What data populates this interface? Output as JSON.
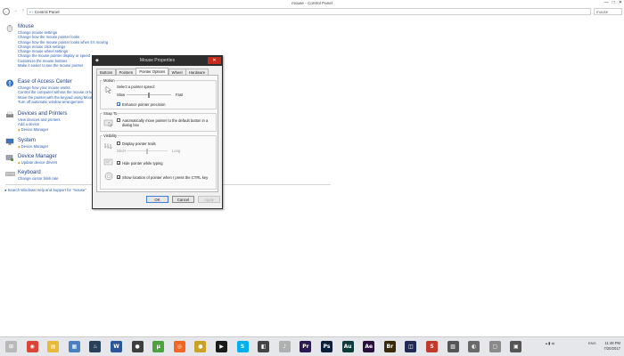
{
  "window": {
    "title": "mouse - Control Panel",
    "controls": [
      "—",
      "□",
      "✕"
    ]
  },
  "address": {
    "path": "Control Panel",
    "search_value": "mouse"
  },
  "nav": {
    "back": "←",
    "forward": "→",
    "up": "↑"
  },
  "sections": [
    {
      "title": "Mouse",
      "icon": "mouse-icon",
      "links": [
        "Change mouse settings",
        "Change how the mouse pointer looks",
        "Change how the mouse pointer looks when it's moving",
        "Change mouse click settings",
        "Change mouse wheel settings",
        "Change the mouse pointer display or speed",
        "Customize the mouse buttons",
        "Make it easier to see the mouse pointer"
      ]
    },
    {
      "title": "Ease of Access Center",
      "icon": "ease-of-access-icon",
      "links": [
        "Change how your mouse works",
        "Control the computer without the mouse or keyboard",
        "Move the pointer with the keypad using MouseKeys",
        "Turn off automatic window arrangement"
      ]
    },
    {
      "title": "Devices and Printers",
      "icon": "devices-printers-icon",
      "links": [
        "View devices and printers",
        "Add a device",
        "Device Manager"
      ]
    },
    {
      "title": "System",
      "icon": "system-icon",
      "links": [
        "Device Manager"
      ]
    },
    {
      "title": "Device Manager",
      "icon": "device-manager-icon",
      "links": [
        "Update device drivers"
      ]
    },
    {
      "title": "Keyboard",
      "icon": "keyboard-icon",
      "links": [
        "Change cursor blink rate"
      ]
    }
  ],
  "help_link": "Search Windows Help and Support for \"mouse\"",
  "dialog": {
    "title": "Mouse Properties",
    "close": "✕",
    "tabs": [
      "Buttons",
      "Pointers",
      "Pointer Options",
      "Wheel",
      "Hardware"
    ],
    "active_tab": "Pointer Options",
    "motion": {
      "label": "Motion",
      "select_speed": "Select a pointer speed:",
      "slow": "Slow",
      "fast": "Fast",
      "speed_level": 0.5,
      "enhance_precision": "Enhance pointer precision",
      "enhance_checked": "✓"
    },
    "snap_to": {
      "label": "Snap To",
      "auto_move": "Automatically move pointer to the default button in a dialog box",
      "checked": ""
    },
    "visibility": {
      "label": "Visibility",
      "display_trails": "Display pointer trails",
      "trails_checked": "",
      "short": "Short",
      "long": "Long",
      "trail_level": 0.5,
      "hide_typing": "Hide pointer while typing",
      "hide_checked": "✓",
      "show_ctrl": "Show location of pointer when I press the CTRL key",
      "ctrl_checked": "✓"
    },
    "buttons": {
      "ok": "OK",
      "cancel": "Cancel",
      "apply": "Apply"
    }
  },
  "taskbar": {
    "apps": [
      {
        "name": "start-icon",
        "label": "⊞",
        "color": "#b8b8b8"
      },
      {
        "name": "chrome-icon",
        "label": "◉",
        "color": "#db4437"
      },
      {
        "name": "file-explorer-icon",
        "label": "▤",
        "color": "#e8b93a"
      },
      {
        "name": "control-panel-icon",
        "label": "▦",
        "color": "#4a7fc1"
      },
      {
        "name": "steam-icon",
        "label": "♨",
        "color": "#2a3f5a"
      },
      {
        "name": "word-icon",
        "label": "W",
        "color": "#2b579a"
      },
      {
        "name": "app-icon",
        "label": "●",
        "color": "#3e3e3e"
      },
      {
        "name": "utorrent-icon",
        "label": "µ",
        "color": "#4ba33d"
      },
      {
        "name": "origin-icon",
        "label": "◎",
        "color": "#f26522"
      },
      {
        "name": "app2-icon",
        "label": "●",
        "color": "#c9a227"
      },
      {
        "name": "media-icon",
        "label": "▶",
        "color": "#1a1a1a"
      },
      {
        "name": "skype-icon",
        "label": "S",
        "color": "#00aff0"
      },
      {
        "name": "app3-icon",
        "label": "◧",
        "color": "#444"
      },
      {
        "name": "itunes-icon",
        "label": "♪",
        "color": "#b0b0b0"
      },
      {
        "name": "premiere-icon",
        "label": "Pr",
        "color": "#2a1a4f"
      },
      {
        "name": "photoshop-icon",
        "label": "Ps",
        "color": "#0b1f3a"
      },
      {
        "name": "audition-icon",
        "label": "Au",
        "color": "#0d3a3a"
      },
      {
        "name": "after-effects-icon",
        "label": "Ae",
        "color": "#2a0e3e"
      },
      {
        "name": "bridge-icon",
        "label": "Br",
        "color": "#3a2a0a"
      },
      {
        "name": "app4-icon",
        "label": "◫",
        "color": "#1f2a55"
      },
      {
        "name": "app5-icon",
        "label": "S",
        "color": "#c0392b"
      },
      {
        "name": "app6-icon",
        "label": "▧",
        "color": "#555"
      },
      {
        "name": "app7-icon",
        "label": "◐",
        "color": "#6a6a6a"
      },
      {
        "name": "app8-icon",
        "label": "▢",
        "color": "#8a8a8a"
      },
      {
        "name": "app9-icon",
        "label": "▣",
        "color": "#555"
      }
    ],
    "tray": "ENG",
    "time": "11:48 PM",
    "date": "7/20/2017"
  }
}
